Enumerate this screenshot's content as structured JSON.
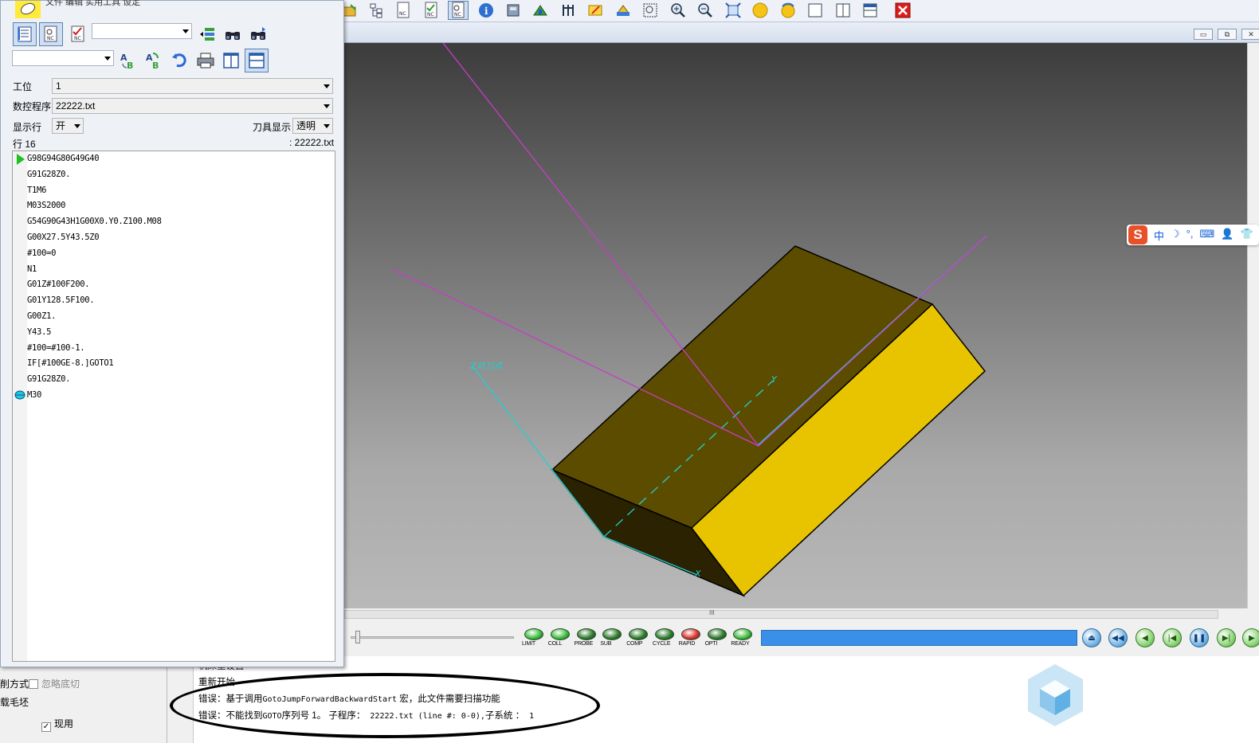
{
  "editor": {
    "menu_items": "文件  编辑  实用工具  设定",
    "station_label": "工位",
    "station_value": "1",
    "program_label": "数控程序",
    "program_value": "22222.txt",
    "show_line_label": "显示行",
    "show_line_value": "开",
    "tool_display_label": "刀具显示",
    "tool_display_value": "透明",
    "line_info": "行 16",
    "file_info": ": 22222.txt",
    "search_value": "",
    "filter_value": "",
    "code_lines": [
      "G98G94G80G49G40",
      "G91G28Z0.",
      "T1M6",
      "M03S2000",
      "G54G90G43H1G00X0.Y0.Z100.M08",
      "G00X27.5Y43.5Z0",
      "#100=0",
      "N1",
      "G01Z#100F200.",
      "G01Y128.5F100.",
      "G00Z1.",
      "Y43.5",
      "#100=#100-1.",
      "IF[#100GE-8.]GOTO1",
      "G91G28Z0.",
      "M30"
    ]
  },
  "viewport": {
    "zero_point_label": "Z对刀点",
    "axis_x": "X",
    "axis_y": "Y",
    "block_top_color": "#5c4c00",
    "block_side_color": "#e8c400",
    "block_dark_color": "#2a2200",
    "toolpath_color": "#c83cc8",
    "axis_color": "#20d0d0",
    "window_minimize": "▭",
    "window_restore": "⧉",
    "window_close": "✕",
    "scroll_grip": "III"
  },
  "status_leds": [
    {
      "label": "LIMIT",
      "color": "#3fbf3f"
    },
    {
      "label": "COLL",
      "color": "#3fbf3f"
    },
    {
      "label": "PROBE",
      "color": "#2e7d2e"
    },
    {
      "label": "SUB",
      "color": "#2e7d2e"
    },
    {
      "label": "COMP",
      "color": "#2e7d2e"
    },
    {
      "label": "CYCLE",
      "color": "#2e7d2e"
    },
    {
      "label": "RAPID",
      "color": "#e03030"
    },
    {
      "label": "OPTI",
      "color": "#2e7d2e"
    },
    {
      "label": "READY",
      "color": "#3fbf3f"
    }
  ],
  "playback": {
    "progress": 1.0,
    "buttons": [
      "eject",
      "rewind",
      "step-back",
      "to-start",
      "pause",
      "to-end",
      "play"
    ]
  },
  "messages": {
    "partial_line_1": "机床重设置",
    "partial_line_2": "重新开始",
    "error_1_prefix": "错误：基于调用",
    "error_1_macro": "GotoJumpForwardBackwardStart",
    "error_1_suffix": " 宏，此文件需要扫描功能",
    "error_2_prefix": "错误：不能找到",
    "error_2_code": "GOTO",
    "error_2_mid": "序列号 1。 子程序：",
    "error_2_detail": " 22222.txt (line #: 0-0),",
    "error_2_suffix": "子系统 ：",
    "error_2_num": " 1"
  },
  "left_panel": {
    "cut_mode_label": "削方式",
    "ignore_bottom_label": "忽略底切",
    "stock_label": "载毛坯",
    "current_label": "现用",
    "current_checked": true
  },
  "ime": {
    "logo": "S",
    "items": [
      "中",
      "☽",
      "°,",
      "⌨",
      "👤",
      "👕"
    ]
  }
}
